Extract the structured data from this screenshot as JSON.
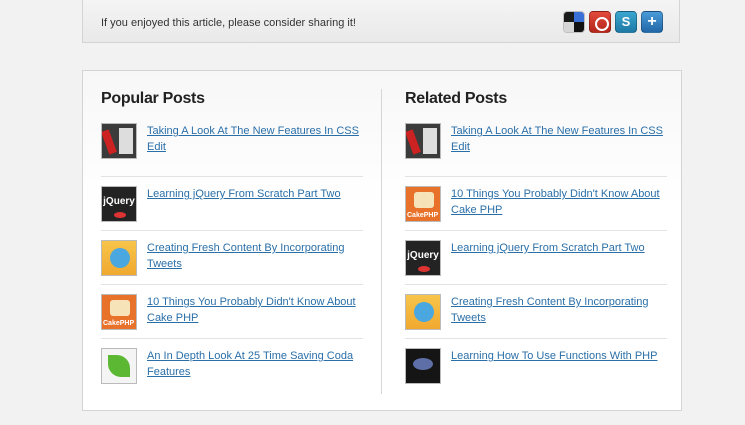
{
  "share": {
    "text": "If you enjoyed this article, please consider sharing it!",
    "icons": [
      "delicious-icon",
      "digg-icon",
      "stumbleupon-icon",
      "plus-icon"
    ]
  },
  "popular": {
    "title": "Popular Posts",
    "items": [
      {
        "label": "Taking A Look At The New Features In CSS Edit",
        "thumb": "css-edit"
      },
      {
        "label": "Learning jQuery From Scratch Part Two",
        "thumb": "jquery"
      },
      {
        "label": "Creating Fresh Content By Incorporating Tweets",
        "thumb": "twitter"
      },
      {
        "label": "10 Things You Probably Didn't Know About Cake PHP",
        "thumb": "cakephp"
      },
      {
        "label": "An In Depth Look At 25 Time Saving Coda Features",
        "thumb": "coda"
      }
    ]
  },
  "related": {
    "title": "Related Posts",
    "items": [
      {
        "label": "Taking A Look At The New Features In CSS Edit",
        "thumb": "css-edit"
      },
      {
        "label": "10 Things You Probably Didn't Know About Cake PHP",
        "thumb": "cakephp"
      },
      {
        "label": "Learning jQuery From Scratch Part Two",
        "thumb": "jquery"
      },
      {
        "label": "Creating Fresh Content By Incorporating Tweets",
        "thumb": "twitter"
      },
      {
        "label": "Learning How To Use Functions With PHP",
        "thumb": "php"
      }
    ]
  },
  "thumb_text": {
    "jquery": "jQuery"
  },
  "colors": {
    "link": "#2a6fa8",
    "background": "#f2f2f2"
  }
}
